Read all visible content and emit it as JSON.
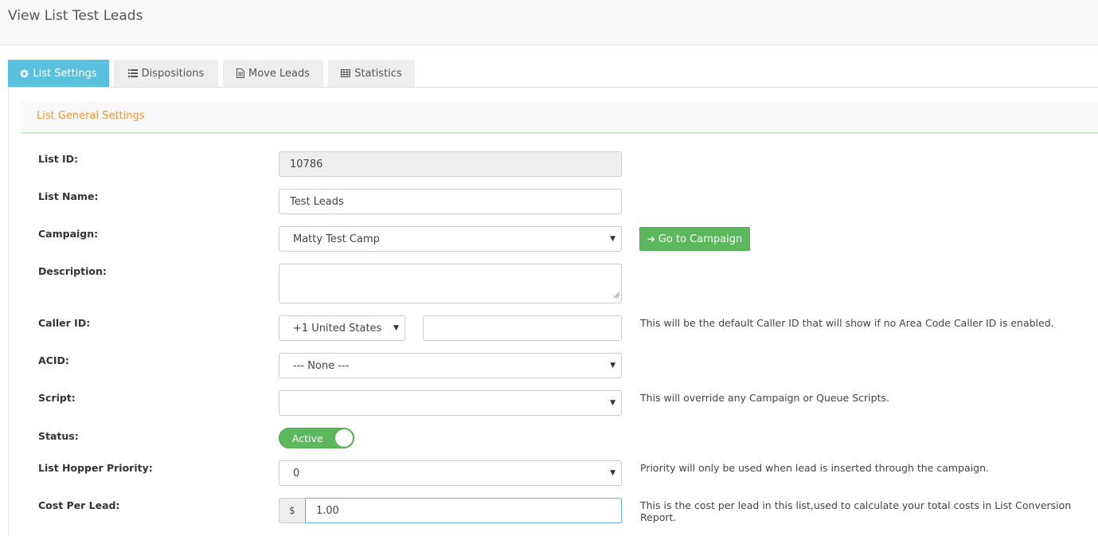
{
  "page": {
    "title": "View List Test Leads"
  },
  "tabs": [
    {
      "label": "List Settings",
      "icon": "gear-icon",
      "active": true
    },
    {
      "label": "Dispositions",
      "icon": "list-icon",
      "active": false
    },
    {
      "label": "Move Leads",
      "icon": "document-icon",
      "active": false
    },
    {
      "label": "Statistics",
      "icon": "table-icon",
      "active": false
    }
  ],
  "section": {
    "title": "List General Settings"
  },
  "form": {
    "list_id": {
      "label": "List ID:",
      "value": "10786"
    },
    "list_name": {
      "label": "List Name:",
      "value": "Test Leads"
    },
    "campaign": {
      "label": "Campaign:",
      "value": "Matty Test Camp",
      "button_label": "Go to Campaign"
    },
    "description": {
      "label": "Description:",
      "value": ""
    },
    "caller_id": {
      "label": "Caller ID:",
      "country": "+1 United States",
      "number": "",
      "help": "This will be the default Caller ID that will show if no Area Code Caller ID is enabled."
    },
    "acid": {
      "label": "ACID:",
      "value": "--- None ---"
    },
    "script": {
      "label": "Script:",
      "value": "",
      "help": "This will override any Campaign or Queue Scripts."
    },
    "status": {
      "label": "Status:",
      "value": "Active"
    },
    "hopper_priority": {
      "label": "List Hopper Priority:",
      "value": "0",
      "help": "Priority will only be used when lead is inserted through the campaign."
    },
    "cost_per_lead": {
      "label": "Cost Per Lead:",
      "currency": "$",
      "value": "1.00",
      "help": "This is the cost per lead in this list,used to calculate your total costs in List Conversion Report."
    }
  },
  "colors": {
    "tab_active": "#5bc0de",
    "section_title": "#f0953a",
    "success": "#5cb85c",
    "focus_border": "#66afe9"
  }
}
